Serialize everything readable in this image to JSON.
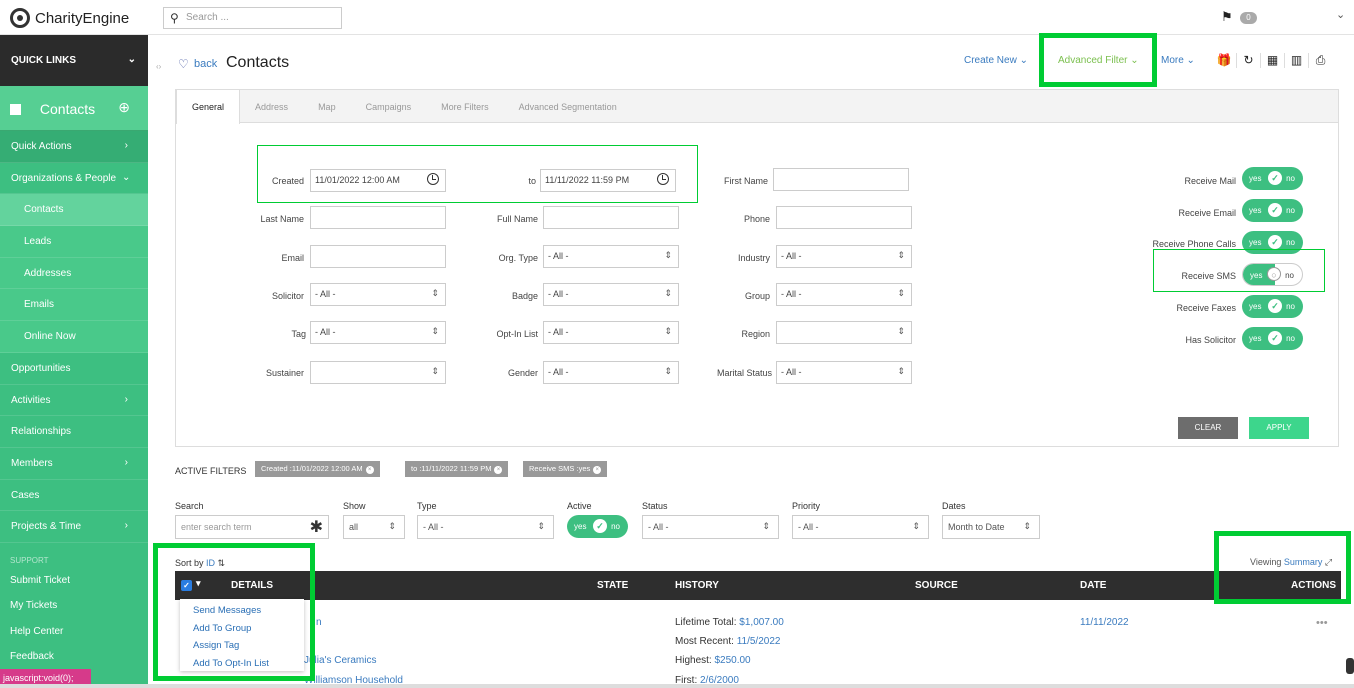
{
  "app": {
    "logo": "CharityEngine",
    "search_placeholder": "Search ...",
    "notif_count": "0"
  },
  "sidebar": {
    "quick_links": "QUICK LINKS",
    "section": "Contacts",
    "items": [
      {
        "label": "Quick Actions",
        "chev": "›"
      },
      {
        "label": "Organizations & People",
        "chev": "⌄"
      },
      {
        "label": "Contacts",
        "chev": ""
      },
      {
        "label": "Leads",
        "chev": ""
      },
      {
        "label": "Addresses",
        "chev": ""
      },
      {
        "label": "Emails",
        "chev": ""
      },
      {
        "label": "Online Now",
        "chev": ""
      },
      {
        "label": "Opportunities",
        "chev": ""
      },
      {
        "label": "Activities",
        "chev": "›"
      },
      {
        "label": "Relationships",
        "chev": ""
      },
      {
        "label": "Members",
        "chev": "›"
      },
      {
        "label": "Cases",
        "chev": ""
      },
      {
        "label": "Projects & Time",
        "chev": "›"
      }
    ],
    "support_label": "SUPPORT",
    "support_items": [
      "Submit Ticket",
      "My Tickets",
      "Help Center",
      "Feedback"
    ],
    "status_link": "javascript:void(0);"
  },
  "header": {
    "back": "back",
    "title": "Contacts",
    "create_new": "Create New ⌄",
    "advanced_filter": "Advanced Filter ⌄",
    "more": "More ⌄"
  },
  "tabs": [
    "General",
    "Address",
    "Map",
    "Campaigns",
    "More Filters",
    "Advanced Segmentation"
  ],
  "filters": {
    "created_label": "Created",
    "created_from": "11/01/2022 12:00 AM",
    "to_label": "to",
    "created_to": "11/11/2022 11:59 PM",
    "first_name": "First Name",
    "last_name": "Last Name",
    "full_name": "Full Name",
    "phone": "Phone",
    "email": "Email",
    "org_type": "Org. Type",
    "industry": "Industry",
    "solicitor": "Solicitor",
    "badge": "Badge",
    "group": "Group",
    "tag": "Tag",
    "optin": "Opt-In List",
    "region": "Region",
    "sustainer": "Sustainer",
    "gender": "Gender",
    "marital": "Marital Status",
    "all": "- All -"
  },
  "toggles": [
    {
      "label": "Receive Mail",
      "yes": "yes",
      "no": "no"
    },
    {
      "label": "Receive Email",
      "yes": "yes",
      "no": "no"
    },
    {
      "label": "Receive Phone Calls",
      "yes": "yes",
      "no": "no"
    },
    {
      "label": "Receive SMS",
      "yes": "yes",
      "no": "no"
    },
    {
      "label": "Receive Faxes",
      "yes": "yes",
      "no": "no"
    },
    {
      "label": "Has Solicitor",
      "yes": "yes",
      "no": "no"
    }
  ],
  "buttons": {
    "clear": "CLEAR",
    "apply": "APPLY"
  },
  "active_filters": {
    "label": "ACTIVE FILTERS",
    "chips": [
      "Created :11/01/2022 12:00 AM",
      "to :11/11/2022 11:59 PM",
      "Receive SMS :yes"
    ]
  },
  "searchbar": {
    "search_label": "Search",
    "search_placeholder": "enter search term",
    "show_label": "Show",
    "show_value": "all",
    "type_label": "Type",
    "type_value": "- All -",
    "active_label": "Active",
    "status_label": "Status",
    "status_value": "- All -",
    "priority_label": "Priority",
    "priority_value": "- All -",
    "dates_label": "Dates",
    "dates_value": "Month to Date"
  },
  "list": {
    "sort_by": "Sort by",
    "sort_field": "ID",
    "viewing": "Viewing",
    "viewing_mode": "Summary",
    "columns": [
      "DETAILS",
      "STATE",
      "HISTORY",
      "SOURCE",
      "DATE",
      "ACTIONS"
    ],
    "bulk_menu": [
      "Send Messages",
      "Add To Group",
      "Assign Tag",
      "Add To Opt-In List"
    ],
    "row": {
      "name_tail": "n",
      "org": "Julia's Ceramics",
      "household": "Williamson Household",
      "lifetime_label": "Lifetime Total:",
      "lifetime": "$1,007.00",
      "recent_label": "Most Recent:",
      "recent": "11/5/2022",
      "highest_label": "Highest:",
      "highest": "$250.00",
      "first_label": "First:",
      "first": "2/6/2000",
      "date": "11/11/2022"
    }
  }
}
